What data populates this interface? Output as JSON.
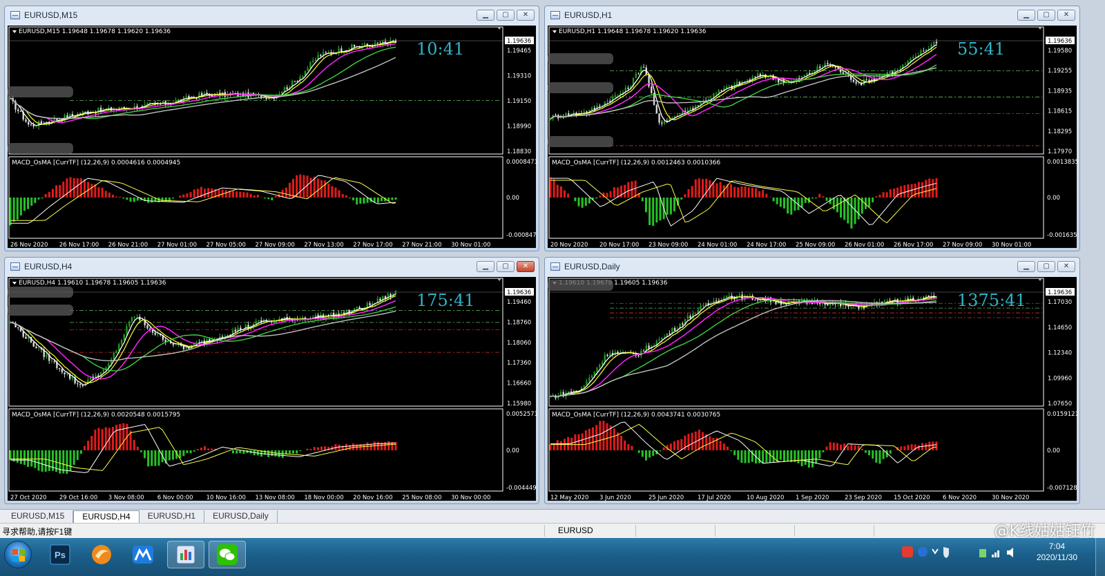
{
  "windows": [
    {
      "key": "m15",
      "title": "EURUSD,M15",
      "legend": "EURUSD,M15  1.19648 1.19678 1.19620 1.19636",
      "price_current": "1.19636",
      "price_ticks": [
        "1.19465",
        "1.19310",
        "1.19150",
        "1.18990",
        "1.18830"
      ],
      "timer": "10:41",
      "macd_legend": "MACD_OsMA [CurrTF] (12,26,9) 0.0004616 0.0004945",
      "macd_ticks": [
        "0.0008471",
        "0.00",
        "-0.000847"
      ],
      "time_labels": [
        "26 Nov 2020",
        "26 Nov 17:00",
        "26 Nov 21:00",
        "27 Nov 01:00",
        "27 Nov 05:00",
        "27 Nov 09:00",
        "27 Nov 13:00",
        "27 Nov 17:00",
        "27 Nov 21:00",
        "30 Nov 01:00"
      ],
      "close_red": false
    },
    {
      "key": "h1",
      "title": "EURUSD,H1",
      "legend": "EURUSD,H1  1.19648 1.19678 1.19620 1.19636",
      "price_current": "1.19636",
      "price_ticks": [
        "1.19580",
        "1.19255",
        "1.18935",
        "1.18615",
        "1.18295",
        "1.17970"
      ],
      "timer": "55:41",
      "macd_legend": "MACD_OsMA [CurrTF] (12,26,9) 0.0012463 0.0010366",
      "macd_ticks": [
        "0.0013835",
        "0.00",
        "-0.001635"
      ],
      "time_labels": [
        "20 Nov 2020",
        "20 Nov 17:00",
        "23 Nov 09:00",
        "24 Nov 01:00",
        "24 Nov 17:00",
        "25 Nov 09:00",
        "26 Nov 01:00",
        "26 Nov 17:00",
        "27 Nov 09:00",
        "30 Nov 01:00"
      ],
      "close_red": false
    },
    {
      "key": "h4",
      "title": "EURUSD,H4",
      "legend": "EURUSD,H4  1.19610 1.19678 1.19605 1.19636",
      "price_current": "1.19636",
      "price_ticks": [
        "1.19460",
        "1.18760",
        "1.18060",
        "1.17360",
        "1.16660",
        "1.15980"
      ],
      "timer": "175:41",
      "macd_legend": "MACD_OsMA [CurrTF] (12,26,9) 0.0020548 0.0015795",
      "macd_ticks": [
        "0.0052571",
        "0.00",
        "-0.004449"
      ],
      "time_labels": [
        "27 Oct 2020",
        "29 Oct 16:00",
        "3 Nov 08:00",
        "6 Nov 00:00",
        "10 Nov 16:00",
        "13 Nov 08:00",
        "18 Nov 00:00",
        "20 Nov 16:00",
        "25 Nov 08:00",
        "30 Nov 00:00"
      ],
      "close_red": true
    },
    {
      "key": "d1",
      "title": "EURUSD,Daily",
      "legend": "1.19610 1.19678 1.19605 1.19636",
      "price_current": "1.19636",
      "price_ticks": [
        "1.17030",
        "1.14650",
        "1.12340",
        "1.09960",
        "1.07650"
      ],
      "timer": "1375:41",
      "macd_legend": "MACD_OsMA [CurrTF] (12,26,9) 0.0043741 0.0030765",
      "macd_ticks": [
        "0.0159121",
        "0.00",
        "-0.007128"
      ],
      "time_labels": [
        "12 May 2020",
        "3 Jun 2020",
        "25 Jun 2020",
        "17 Jul 2020",
        "10 Aug 2020",
        "1 Sep 2020",
        "23 Sep 2020",
        "15 Oct 2020",
        "6 Nov 2020",
        "30 Nov 2020"
      ],
      "close_red": false
    }
  ],
  "tabs": [
    "EURUSD,M15",
    "EURUSD,H4",
    "EURUSD,H1",
    "EURUSD,Daily"
  ],
  "active_tab": "EURUSD,H4",
  "status": {
    "help": "寻求帮助,请按F1键",
    "symbol": "EURUSD",
    "watermark": "@K线姑姑钰竹"
  },
  "taskbar": {
    "apps": [
      {
        "name": "photoshop-icon",
        "label": "Ps"
      },
      {
        "name": "browser-icon",
        "label": ""
      },
      {
        "name": "app-m-icon",
        "label": ""
      },
      {
        "name": "metatrader-icon",
        "label": ""
      },
      {
        "name": "wechat-icon",
        "label": ""
      }
    ],
    "time": "7:04",
    "date": "2020/11/30"
  },
  "colors": {
    "bull_hist": "#e21b1b",
    "bear_hist": "#27c227",
    "timer": "#2fb5c9",
    "ma_white": "#ffffff",
    "ma_yellow": "#ffff2a",
    "ma_magenta": "#ff22ff",
    "ma_green": "#3fcf3f",
    "ma_gray": "#c0c0c0"
  }
}
